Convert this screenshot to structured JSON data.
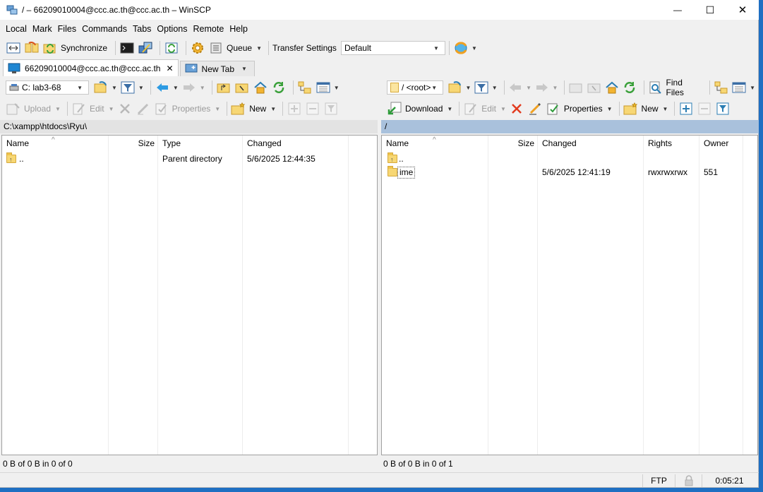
{
  "window": {
    "title": "/ – 66209010004@ccc.ac.th@ccc.ac.th – WinSCP",
    "minimize": "—",
    "maximize": "☐",
    "close": "✕"
  },
  "menu": [
    "Local",
    "Mark",
    "Files",
    "Commands",
    "Tabs",
    "Options",
    "Remote",
    "Help"
  ],
  "toolbar": {
    "synchronize": "Synchronize",
    "queue": "Queue",
    "transfer_settings": "Transfer Settings",
    "transfer_profile": "Default"
  },
  "tabs": {
    "session": "66209010004@ccc.ac.th@ccc.ac.th",
    "close": "✕",
    "new_tab": "New Tab"
  },
  "left": {
    "drive": "C: lab3-68",
    "upload": "Upload",
    "edit": "Edit",
    "properties": "Properties",
    "new": "New",
    "path": "C:\\xampp\\htdocs\\Ryu\\",
    "columns": [
      "Name",
      "Size",
      "Type",
      "Changed"
    ],
    "rows": [
      {
        "name": "..",
        "size": "",
        "type": "Parent directory",
        "changed": "5/6/2025 12:44:35"
      }
    ],
    "status": "0 B of 0 B in 0 of 0"
  },
  "right": {
    "dir": "/ <root>",
    "find_files": "Find Files",
    "download": "Download",
    "edit": "Edit",
    "properties": "Properties",
    "new": "New",
    "path": "/",
    "columns": [
      "Name",
      "Size",
      "Changed",
      "Rights",
      "Owner"
    ],
    "rows": [
      {
        "name": "..",
        "size": "",
        "changed": "",
        "rights": "",
        "owner": ""
      },
      {
        "name": "ime",
        "size": "",
        "changed": "5/6/2025 12:41:19",
        "rights": "rwxrwxrwx",
        "owner": "551"
      }
    ],
    "status": "0 B of 0 B in 0 of 1"
  },
  "statusbar": {
    "protocol": "FTP",
    "elapsed": "0:05:21"
  },
  "colors": {
    "accent": "#1f6fc2",
    "right_path_bg": "#a9c1dc",
    "left_path_bg": "#e3e3e3"
  }
}
